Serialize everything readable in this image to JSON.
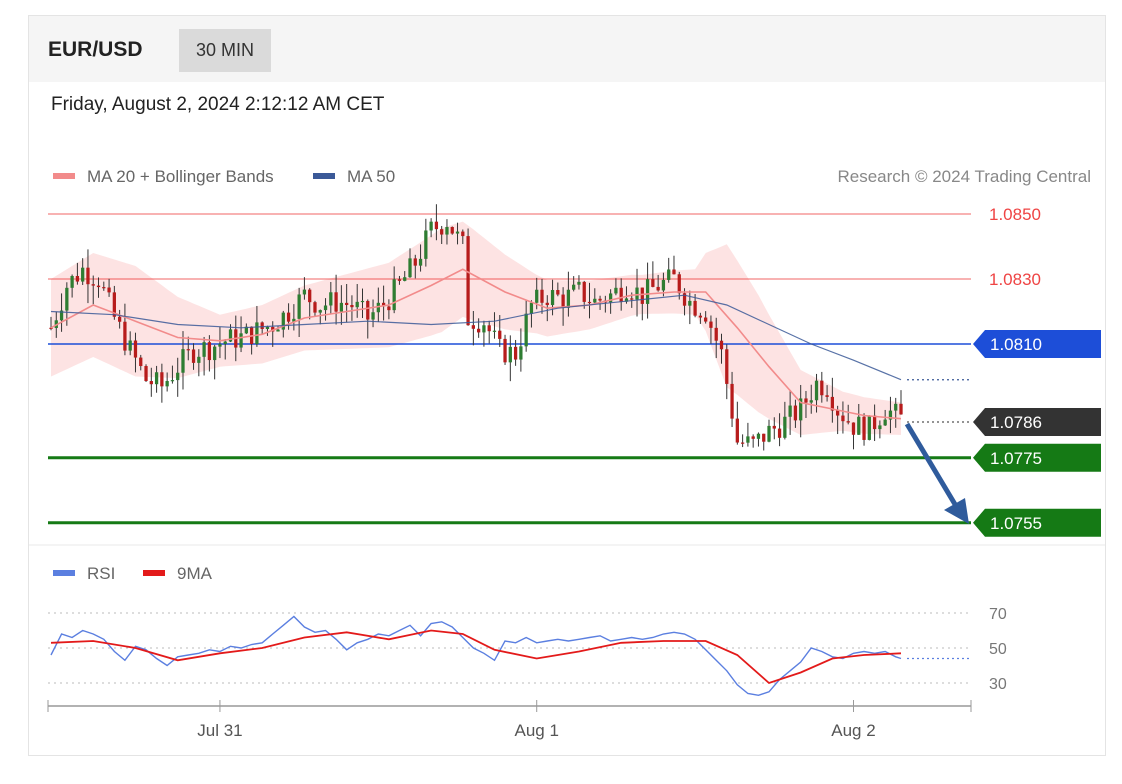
{
  "header": {
    "symbol": "EUR/USD",
    "timeframe": "30 MIN",
    "datetime": "Friday, August 2, 2024 2:12:12 AM CET"
  },
  "legend": {
    "ma20_label": "MA 20 + Bollinger Bands",
    "ma50_label": "MA 50",
    "credit": "Research © 2024 Trading Central",
    "rsi_label": "RSI",
    "ma9_label": "9MA"
  },
  "colors": {
    "ma20": "#f28b8b",
    "ma50": "#3b5998",
    "band_fill": "#fde0e0",
    "bull": "#2e7d32",
    "bear": "#b71c1c",
    "resistance": "#ef4444",
    "pivot": "#1d4ed8",
    "support": "#157a15",
    "current": "#333333",
    "rsi": "#5b7fe0",
    "rsi_ma": "#e31a1a",
    "arrow": "#2f5b9c"
  },
  "chart_data": [
    {
      "type": "candlestick",
      "ylim": [
        1.0745,
        1.0855
      ],
      "x_ticks": [
        "Jul 31",
        "Aug 1",
        "Aug 2"
      ],
      "x_tick_index": [
        32,
        92,
        152
      ],
      "bars": 162,
      "levels": [
        {
          "label": "1.0850",
          "value": 1.085,
          "kind": "resistance"
        },
        {
          "label": "1.0830",
          "value": 1.083,
          "kind": "resistance"
        },
        {
          "label": "1.0810",
          "value": 1.081,
          "kind": "pivot"
        },
        {
          "label": "1.0786",
          "value": 1.0786,
          "kind": "current"
        },
        {
          "label": "1.0775",
          "value": 1.0775,
          "kind": "support"
        },
        {
          "label": "1.0755",
          "value": 1.0755,
          "kind": "support"
        }
      ],
      "close_path": [
        [
          0,
          1.0815
        ],
        [
          3,
          1.0828
        ],
        [
          6,
          1.0833
        ],
        [
          9,
          1.083
        ],
        [
          12,
          1.0818
        ],
        [
          15,
          1.0808
        ],
        [
          18,
          1.0799
        ],
        [
          21,
          1.0797
        ],
        [
          24,
          1.0803
        ],
        [
          27,
          1.0808
        ],
        [
          30,
          1.0809
        ],
        [
          33,
          1.0811
        ],
        [
          36,
          1.0812
        ],
        [
          39,
          1.0814
        ],
        [
          42,
          1.0816
        ],
        [
          45,
          1.082
        ],
        [
          48,
          1.0825
        ],
        [
          51,
          1.0822
        ],
        [
          54,
          1.0823
        ],
        [
          57,
          1.0822
        ],
        [
          60,
          1.0818
        ],
        [
          63,
          1.0822
        ],
        [
          66,
          1.0828
        ],
        [
          69,
          1.0835
        ],
        [
          72,
          1.0845
        ],
        [
          75,
          1.0848
        ],
        [
          78,
          1.084
        ],
        [
          79,
          1.0818
        ],
        [
          82,
          1.0817
        ],
        [
          85,
          1.0808
        ],
        [
          88,
          1.0807
        ],
        [
          91,
          1.0822
        ],
        [
          94,
          1.0825
        ],
        [
          97,
          1.0824
        ],
        [
          100,
          1.0826
        ],
        [
          103,
          1.0823
        ],
        [
          106,
          1.0825
        ],
        [
          109,
          1.0828
        ],
        [
          112,
          1.0825
        ],
        [
          115,
          1.0828
        ],
        [
          118,
          1.083
        ],
        [
          121,
          1.0823
        ],
        [
          124,
          1.082
        ],
        [
          127,
          1.0807
        ],
        [
          128,
          1.0798
        ],
        [
          130,
          1.078
        ],
        [
          133,
          1.0779
        ],
        [
          136,
          1.0783
        ],
        [
          139,
          1.0786
        ],
        [
          142,
          1.079
        ],
        [
          145,
          1.0798
        ],
        [
          147,
          1.0797
        ],
        [
          149,
          1.079
        ],
        [
          152,
          1.0785
        ],
        [
          155,
          1.0784
        ],
        [
          158,
          1.079
        ],
        [
          161,
          1.0787
        ]
      ],
      "ma50_path": [
        [
          0,
          1.082
        ],
        [
          12,
          1.0819
        ],
        [
          24,
          1.0816
        ],
        [
          36,
          1.0815
        ],
        [
          48,
          1.0816
        ],
        [
          60,
          1.0817
        ],
        [
          72,
          1.0816
        ],
        [
          84,
          1.0817
        ],
        [
          96,
          1.0821
        ],
        [
          108,
          1.0823
        ],
        [
          120,
          1.0825
        ],
        [
          128,
          1.0822
        ],
        [
          136,
          1.0816
        ],
        [
          144,
          1.081
        ],
        [
          152,
          1.0805
        ],
        [
          161,
          1.0799
        ]
      ],
      "ma20_path": [
        [
          0,
          1.0815
        ],
        [
          8,
          1.0822
        ],
        [
          16,
          1.0817
        ],
        [
          24,
          1.0812
        ],
        [
          32,
          1.0811
        ],
        [
          40,
          1.0813
        ],
        [
          48,
          1.0818
        ],
        [
          56,
          1.082
        ],
        [
          64,
          1.0822
        ],
        [
          72,
          1.0828
        ],
        [
          78,
          1.0833
        ],
        [
          86,
          1.0826
        ],
        [
          94,
          1.0821
        ],
        [
          102,
          1.0822
        ],
        [
          110,
          1.0825
        ],
        [
          118,
          1.0826
        ],
        [
          124,
          1.0826
        ],
        [
          130,
          1.0815
        ],
        [
          136,
          1.0803
        ],
        [
          142,
          1.0792
        ],
        [
          148,
          1.079
        ],
        [
          154,
          1.0788
        ],
        [
          161,
          1.0787
        ]
      ],
      "band_width_path": [
        [
          0,
          0.0015
        ],
        [
          16,
          0.0017
        ],
        [
          32,
          0.0008
        ],
        [
          48,
          0.001
        ],
        [
          64,
          0.0013
        ],
        [
          74,
          0.0016
        ],
        [
          80,
          0.0014
        ],
        [
          92,
          0.0009
        ],
        [
          112,
          0.0006
        ],
        [
          122,
          0.0007
        ],
        [
          128,
          0.0022
        ],
        [
          134,
          0.0018
        ],
        [
          142,
          0.001
        ],
        [
          150,
          0.0006
        ],
        [
          161,
          0.0005
        ]
      ]
    },
    {
      "type": "line",
      "title": "RSI",
      "yticks": [
        "70",
        "50",
        "30"
      ],
      "ytick_values": [
        70,
        50,
        30
      ],
      "ylim": [
        20,
        78
      ],
      "series": [
        {
          "name": "RSI",
          "values": [
            [
              0,
              46
            ],
            [
              2,
              58
            ],
            [
              4,
              56
            ],
            [
              6,
              60
            ],
            [
              8,
              58
            ],
            [
              10,
              55
            ],
            [
              12,
              48
            ],
            [
              14,
              43
            ],
            [
              16,
              51
            ],
            [
              18,
              49
            ],
            [
              20,
              44
            ],
            [
              22,
              40
            ],
            [
              24,
              45
            ],
            [
              26,
              46
            ],
            [
              28,
              47
            ],
            [
              30,
              49
            ],
            [
              32,
              48
            ],
            [
              34,
              51
            ],
            [
              36,
              50
            ],
            [
              38,
              52
            ],
            [
              40,
              53
            ],
            [
              42,
              58
            ],
            [
              44,
              63
            ],
            [
              46,
              68
            ],
            [
              48,
              62
            ],
            [
              50,
              59
            ],
            [
              52,
              60
            ],
            [
              54,
              55
            ],
            [
              56,
              49
            ],
            [
              58,
              53
            ],
            [
              60,
              55
            ],
            [
              62,
              58
            ],
            [
              64,
              57
            ],
            [
              66,
              60
            ],
            [
              68,
              63
            ],
            [
              70,
              57
            ],
            [
              72,
              64
            ],
            [
              74,
              65
            ],
            [
              76,
              62
            ],
            [
              78,
              56
            ],
            [
              80,
              50
            ],
            [
              82,
              47
            ],
            [
              84,
              43
            ],
            [
              86,
              54
            ],
            [
              88,
              53
            ],
            [
              90,
              56
            ],
            [
              92,
              53
            ],
            [
              94,
              54
            ],
            [
              96,
              55
            ],
            [
              98,
              54
            ],
            [
              100,
              55
            ],
            [
              102,
              56
            ],
            [
              104,
              57
            ],
            [
              106,
              54
            ],
            [
              108,
              55
            ],
            [
              110,
              56
            ],
            [
              112,
              55
            ],
            [
              114,
              56
            ],
            [
              116,
              58
            ],
            [
              118,
              59
            ],
            [
              120,
              58
            ],
            [
              122,
              55
            ],
            [
              124,
              49
            ],
            [
              126,
              43
            ],
            [
              128,
              37
            ],
            [
              130,
              29
            ],
            [
              132,
              24
            ],
            [
              134,
              23
            ],
            [
              136,
              25
            ],
            [
              138,
              32
            ],
            [
              140,
              37
            ],
            [
              142,
              42
            ],
            [
              144,
              50
            ],
            [
              146,
              48
            ],
            [
              148,
              45
            ],
            [
              150,
              44
            ],
            [
              152,
              47
            ],
            [
              154,
              48
            ],
            [
              156,
              47
            ],
            [
              158,
              48
            ],
            [
              160,
              45
            ],
            [
              161,
              44
            ]
          ]
        },
        {
          "name": "9MA",
          "values": [
            [
              0,
              53
            ],
            [
              8,
              54
            ],
            [
              16,
              50
            ],
            [
              24,
              43
            ],
            [
              32,
              47
            ],
            [
              40,
              50
            ],
            [
              48,
              56
            ],
            [
              56,
              59
            ],
            [
              64,
              55
            ],
            [
              72,
              60
            ],
            [
              78,
              58
            ],
            [
              84,
              49
            ],
            [
              92,
              44
            ],
            [
              100,
              48
            ],
            [
              108,
              53
            ],
            [
              116,
              54
            ],
            [
              124,
              54
            ],
            [
              130,
              46
            ],
            [
              136,
              30
            ],
            [
              142,
              36
            ],
            [
              148,
              44
            ],
            [
              154,
              46
            ],
            [
              161,
              47
            ]
          ]
        }
      ]
    }
  ]
}
